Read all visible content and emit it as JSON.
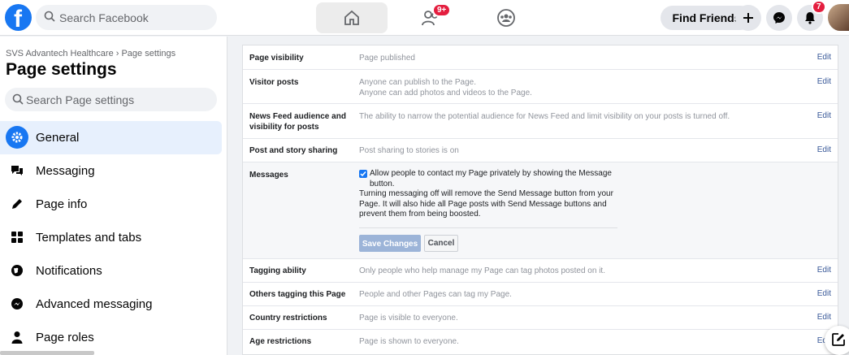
{
  "search": {
    "placeholder": "Search Facebook"
  },
  "nav": {
    "friends_badge": "9+",
    "notifications_badge": "7"
  },
  "topbar": {
    "find_friends_label": "Find Friends"
  },
  "sidebar": {
    "breadcrumb": "SVS Advantech Healthcare › Page settings",
    "title": "Page settings",
    "search_placeholder": "Search Page settings",
    "items": [
      {
        "label": "General",
        "icon": "gear-icon"
      },
      {
        "label": "Messaging",
        "icon": "chat-bubbles-icon"
      },
      {
        "label": "Page info",
        "icon": "pencil-icon"
      },
      {
        "label": "Templates and tabs",
        "icon": "grid-icon"
      },
      {
        "label": "Notifications",
        "icon": "globe-icon"
      },
      {
        "label": "Advanced messaging",
        "icon": "messenger-icon"
      },
      {
        "label": "Page roles",
        "icon": "person-icon"
      }
    ]
  },
  "settings": {
    "edit_label": "Edit",
    "rows": [
      {
        "label": "Page visibility",
        "value": "Page published"
      },
      {
        "label": "Visitor posts",
        "value": "Anyone can publish to the Page.",
        "value2": "Anyone can add photos and videos to the Page."
      },
      {
        "label": "News Feed audience and visibility for posts",
        "value": "The ability to narrow the potential audience for News Feed and limit visibility on your posts is turned off."
      },
      {
        "label": "Post and story sharing",
        "value": "Post sharing to stories is on"
      },
      {
        "label": "Messages"
      },
      {
        "label": "Tagging ability",
        "value": "Only people who help manage my Page can tag photos posted on it."
      },
      {
        "label": "Others tagging this Page",
        "value": "People and other Pages can tag my Page."
      },
      {
        "label": "Country restrictions",
        "value": "Page is visible to everyone."
      },
      {
        "label": "Age restrictions",
        "value": "Page is shown to everyone."
      }
    ],
    "messages": {
      "checkbox_label": "Allow people to contact my Page privately by showing the Message button.",
      "checked": true,
      "note": "Turning messaging off will remove the Send Message button from your Page. It will also hide all Page posts with Send Message buttons and prevent them from being boosted.",
      "save_label": "Save Changes",
      "cancel_label": "Cancel"
    }
  },
  "colors": {
    "accent": "#1877f2",
    "link": "#385898",
    "badge": "#e41e3f"
  }
}
